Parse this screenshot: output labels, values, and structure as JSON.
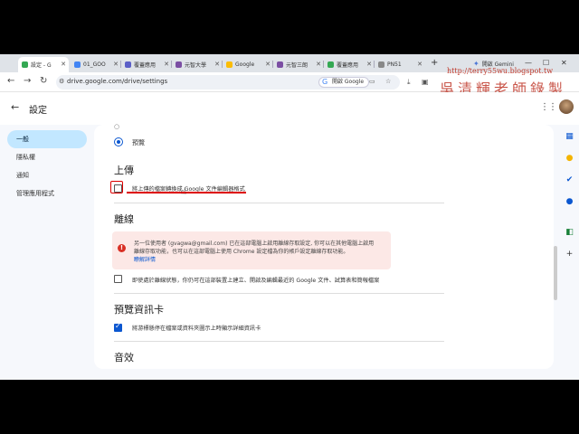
{
  "browser": {
    "tabs": [
      {
        "label": "設定 - G",
        "color": "#34a853"
      },
      {
        "label": "01_GOO",
        "color": "#4285f4"
      },
      {
        "label": "覆蓋應用",
        "color": "#5b5fc7"
      },
      {
        "label": "元智大學",
        "color": "#7b4ea3"
      },
      {
        "label": "Google",
        "color": "#fbbc05"
      },
      {
        "label": "元智三朗",
        "color": "#7b4ea3"
      },
      {
        "label": "覆蓋應用",
        "color": "#34a853"
      },
      {
        "label": "PN51",
        "color": "#888888"
      }
    ],
    "new_tab": "+",
    "gemini_label": "開啟 Gemini",
    "url": "drive.google.com/drive/settings",
    "google_chip": "開啟 Google"
  },
  "watermark": {
    "url": "http://terry55wu.blogspot.tw",
    "name": "吳清輝老師錄製"
  },
  "header": {
    "title": "設定"
  },
  "nav": {
    "items": [
      "一般",
      "隱私權",
      "通知",
      "管理應用程式"
    ]
  },
  "main": {
    "radio_label": "預覽",
    "upload": {
      "heading": "上傳",
      "convert_label": "將上傳的檔案轉換成 Google 文件編輯器格式"
    },
    "offline": {
      "heading": "離線",
      "alert_line1": "另一位使用者 (gvagwa@gmail.com) 已在這部電腦上啟用離線存取設定, 你可以在其他電腦上啟用",
      "alert_line2": "離線存取功能，也可以在這部電腦上使用 Chrome 設定檔為你的帳戶設定離線存取功能。",
      "learn_more": "瞭解詳情",
      "offline_label": "即使處於離線狀態，你仍可在這部裝置上建立、開啟及編輯最近的 Google 文件、試算表和簡報檔案"
    },
    "preview_cards": {
      "heading": "預覽資訊卡",
      "label": "將游標懸停在檔案或資料夾圖示上時顯示詳細資訊卡"
    },
    "sound": {
      "heading": "音效"
    }
  },
  "colors": {
    "accent": "#0b57d0",
    "nav_selected": "#c2e7ff",
    "alert_bg": "#fce8e6",
    "annotation_red": "#dd0000"
  }
}
